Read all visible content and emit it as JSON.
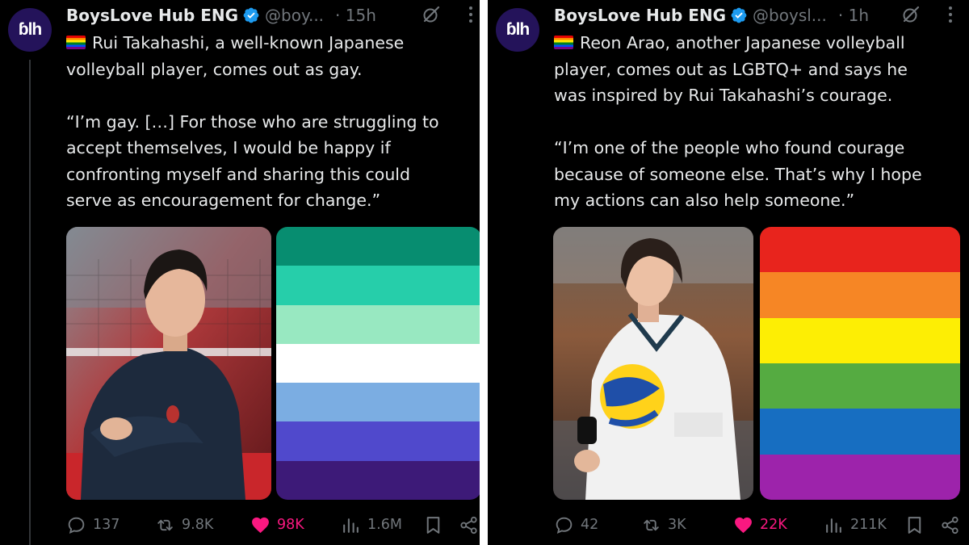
{
  "colors": {
    "background": "#000000",
    "text": "#e7e9ea",
    "muted": "#71767b",
    "like": "#f91880",
    "verified": "#1d9bf0",
    "avatar": "#24135a"
  },
  "posts": [
    {
      "avatar_text": "ɓlh",
      "author_name": "BoysLove Hub ENG",
      "handle": "@boy...",
      "time": "· 15h",
      "icons": [
        "verified-badge-icon",
        "grok-icon",
        "more-icon"
      ],
      "text": "Rui Takahashi, a well-known Japanese\nvolleyball player, comes out as gay.\n\n“I’m gay. […] For those who are struggling to\naccept themselves, I would be happy if\nconfronting myself and sharing this could\nserve as encouragement for change.”",
      "media_photo": "Rui Takahashi standing with arms crossed in a navy team jacket",
      "flag_name": "gay men’s pride flag",
      "flag_colors": [
        "#078d70",
        "#26ceaa",
        "#98e8c1",
        "#ffffff",
        "#7bade2",
        "#5049cc",
        "#3d1a78"
      ],
      "stats": {
        "replies": "137",
        "reposts": "9.8K",
        "likes": "98K",
        "views": "1.6M"
      }
    },
    {
      "avatar_text": "ɓlh",
      "author_name": "BoysLove Hub ENG",
      "handle": "@boysl...",
      "time": "· 1h",
      "icons": [
        "verified-badge-icon",
        "grok-icon",
        "more-icon"
      ],
      "text": "Reon Arao, another Japanese volleyball\nplayer, comes out as LGBTQ+ and says he\nwas inspired by Rui Takahashi’s courage.\n\n“I’m one of the people who found courage\nbecause of someone else. That’s why I hope\nmy actions can also help someone.”",
      "media_photo": "Reon Arao in a white jersey holding a yellow and blue volleyball",
      "flag_name": "rainbow pride flag",
      "flag_colors": [
        "#e8241d",
        "#f68625",
        "#fdee04",
        "#55ab41",
        "#176ec1",
        "#9d23ab"
      ],
      "stats": {
        "replies": "42",
        "reposts": "3K",
        "likes": "22K",
        "views": "211K"
      }
    }
  ]
}
